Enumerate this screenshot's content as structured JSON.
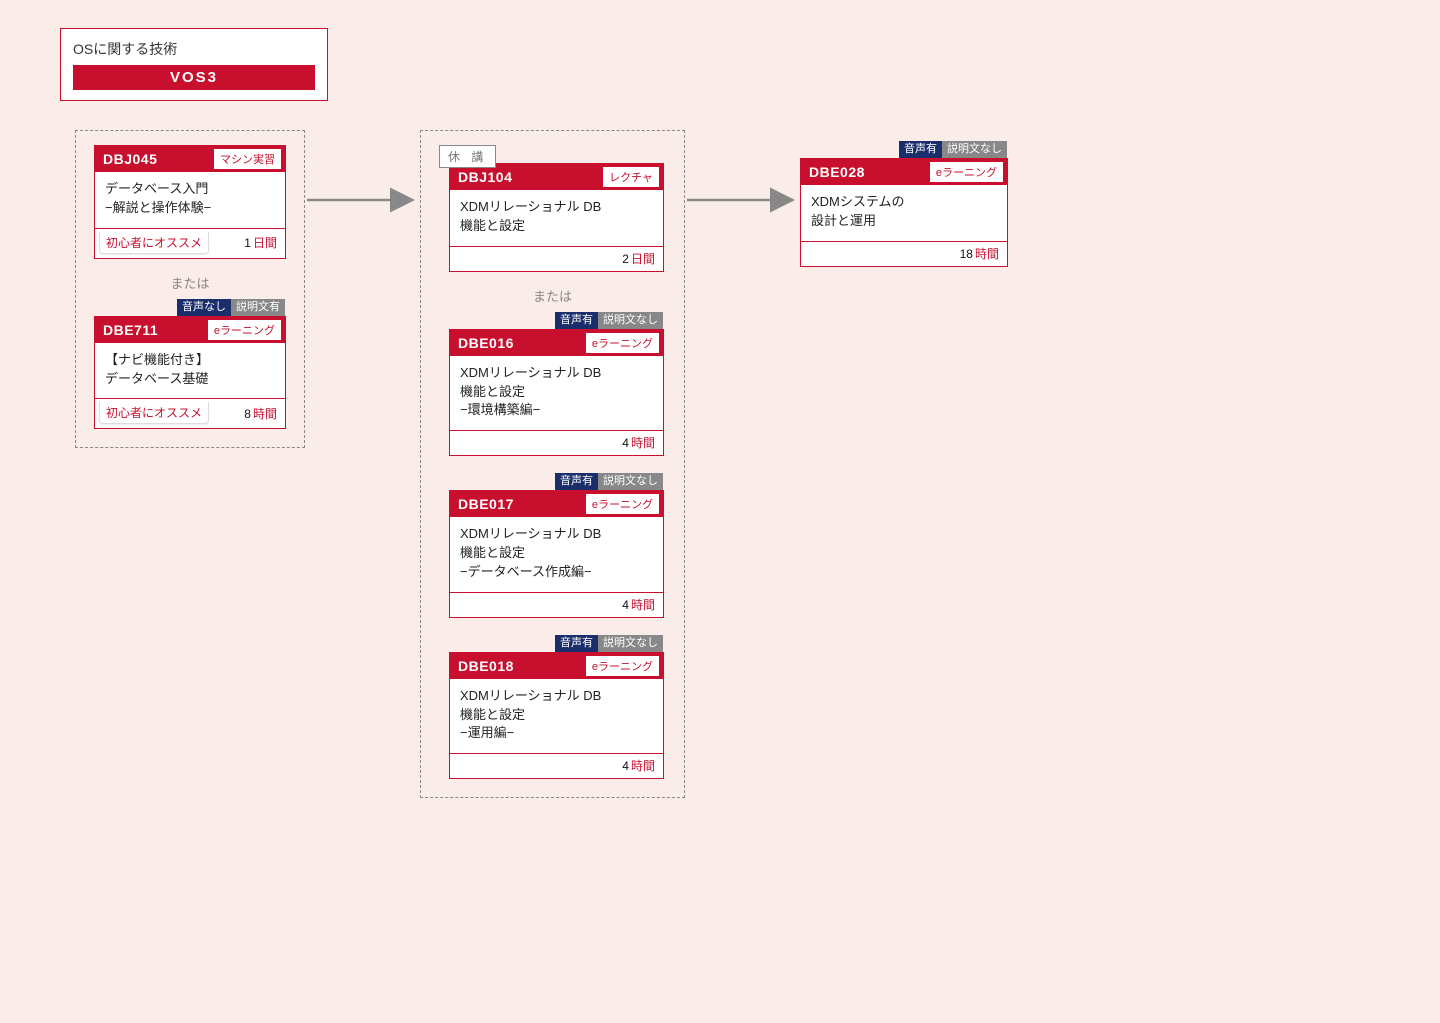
{
  "header": {
    "title": "OSに関する技術",
    "bar": "VOS3"
  },
  "labels": {
    "or": "または",
    "suspend": "休 講"
  },
  "audio": {
    "nashi_ari": {
      "l": "音声なし",
      "r": "説明文有"
    },
    "ari_nashi": {
      "l": "音声有",
      "r": "説明文なし"
    }
  },
  "col1": {
    "c1": {
      "code": "DBJ045",
      "type": "マシン実習",
      "title": "データベース入門\n−解説と操作体験−",
      "recommend": "初心者にオススメ",
      "dur_n": "1",
      "dur_u": "日間"
    },
    "c2": {
      "code": "DBE711",
      "type": "eラーニング",
      "title": "【ナビ機能付き】\nデータベース基礎",
      "recommend": "初心者にオススメ",
      "dur_n": "8",
      "dur_u": "時間"
    }
  },
  "col2": {
    "c1": {
      "code": "DBJ104",
      "type": "レクチャ",
      "title": "XDMリレーショナル DB\n機能と設定",
      "dur_n": "2",
      "dur_u": "日間"
    },
    "c2": {
      "code": "DBE016",
      "type": "eラーニング",
      "title": "XDMリレーショナル DB\n機能と設定\n−環境構築編−",
      "dur_n": "4",
      "dur_u": "時間"
    },
    "c3": {
      "code": "DBE017",
      "type": "eラーニング",
      "title": "XDMリレーショナル DB\n機能と設定\n−データベース作成編−",
      "dur_n": "4",
      "dur_u": "時間"
    },
    "c4": {
      "code": "DBE018",
      "type": "eラーニング",
      "title": "XDMリレーショナル DB\n機能と設定\n−運用編−",
      "dur_n": "4",
      "dur_u": "時間"
    }
  },
  "col3": {
    "c1": {
      "code": "DBE028",
      "type": "eラーニング",
      "title": "XDMシステムの\n設計と運用",
      "dur_n": "18",
      "dur_u": "時間"
    }
  }
}
